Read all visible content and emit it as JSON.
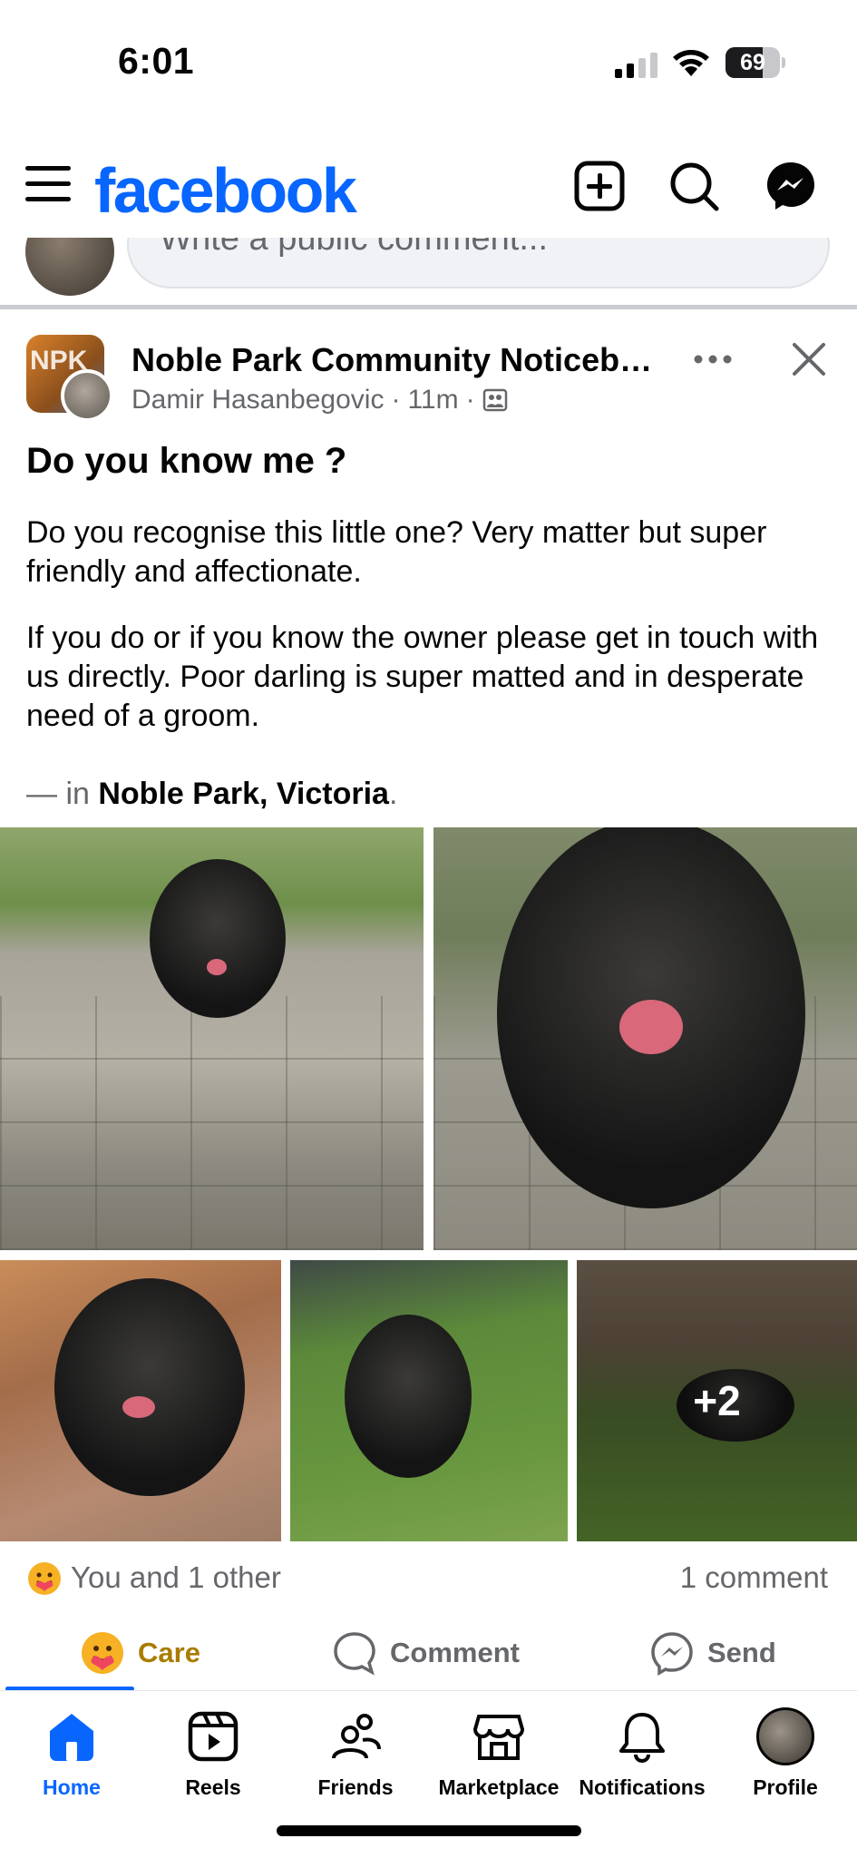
{
  "status_bar": {
    "time": "6:01",
    "battery": "69",
    "battery_level": 0.69
  },
  "header": {
    "logo": "facebook",
    "brand_color": "#0866ff",
    "icons": [
      "menu-icon",
      "plus-icon",
      "search-icon",
      "messenger-icon"
    ]
  },
  "comment_peek": {
    "placeholder": "Write a public comment..."
  },
  "post": {
    "group_name": "Noble Park Community Noticebo...",
    "author": "Damir Hasanbegovic",
    "separator": "·",
    "time_ago": "11m",
    "page_avatar_text": "NPK",
    "title": "Do you know me ?",
    "paragraph_1": "Do you recognise this little one? Very matter but super friendly and affectionate.",
    "paragraph_2": "If you do or if you know the owner please get in touch with us directly. Poor darling is super matted and in desperate need of a groom.",
    "location_prefix": "— in ",
    "location": "Noble Park, Victoria",
    "location_suffix": ".",
    "more_photos": "+2"
  },
  "reactions": {
    "summary": "You and 1 other",
    "comments": "1 comment"
  },
  "actions": {
    "care": "Care",
    "comment": "Comment",
    "send": "Send",
    "care_color": "#a87c00"
  },
  "nav": {
    "home": "Home",
    "reels": "Reels",
    "friends": "Friends",
    "marketplace": "Marketplace",
    "notifications": "Notifications",
    "profile": "Profile"
  }
}
